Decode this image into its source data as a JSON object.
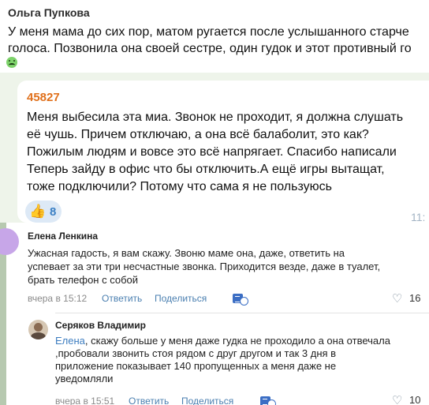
{
  "message1": {
    "author": "Ольга Пупкова",
    "lines": [
      "У меня мама до сих пор, матом ругается после услышанного старче",
      "голоса. Позвонила она своей сестре, один гудок и этот противный го"
    ],
    "emoji": "nauseated-face-icon"
  },
  "message2": {
    "author": "45827",
    "lines": [
      "Меня выбесила эта миа. Звонок не проходит, я должна слушать",
      "её чушь. Причем отключаю, а она всё балаболит, это как?",
      "Пожилым людям и вовсе это всё напрягает. Спасибо написали",
      "Теперь зайду в офис что бы отключить.А ещё игры вытащат,",
      "тоже подключили? Потому что сама я не пользуюсь"
    ],
    "reaction_emoji": "👍",
    "reaction_count": "8",
    "time": "11:"
  },
  "comments": [
    {
      "name": "Елена Ленкина",
      "lines": [
        "Ужасная гадость, я вам скажу. Звоню маме она, даже, ответить на",
        "успевает за эти три несчастные звонка. Приходится везде, даже в туалет,",
        "брать телефон с собой"
      ],
      "time": "вчера в 15:12",
      "reply_label": "Ответить",
      "share_label": "Поделиться",
      "likes": "16"
    },
    {
      "name": "Серяков Владимир",
      "mention": "Елена",
      "lines": [
        ", скажу больше у меня даже гудка не проходило а она отвечала",
        ",пробовали звонить стоя рядом с друг другом и так 3 дня в",
        "приложение показывает 140 пропущенных а меня даже не",
        "уведомляли"
      ],
      "time": "вчера в 15:51",
      "reply_label": "Ответить",
      "share_label": "Поделиться",
      "likes": "10"
    }
  ],
  "colors": {
    "author_orange": "#e0701b",
    "link_blue": "#4a7fb0",
    "reaction_bg": "#dde9f6",
    "chat_bg": "#eef4ea"
  }
}
